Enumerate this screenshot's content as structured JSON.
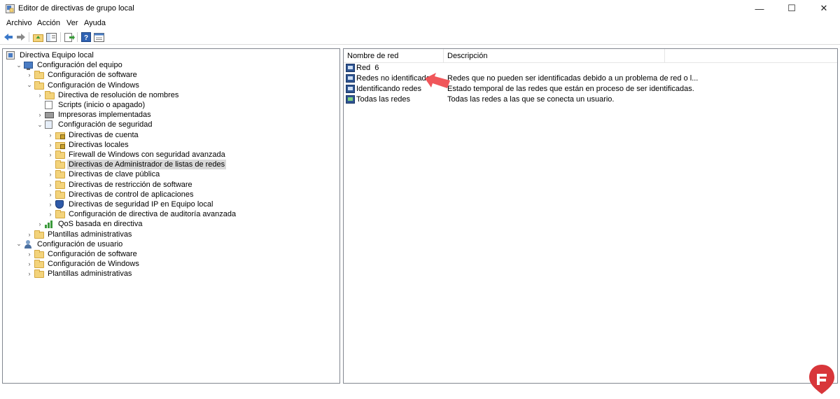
{
  "window": {
    "title": "Editor de directivas de grupo local",
    "controls": {
      "minimize": "—",
      "maximize": "☐",
      "close": "✕"
    }
  },
  "menu": [
    "Archivo",
    "Acción",
    "Ver",
    "Ayuda"
  ],
  "toolbar": {
    "buttons": [
      "back-arrow-icon",
      "forward-arrow-icon",
      "up-folder-icon",
      "show-hide-tree-icon",
      "export-list-icon",
      "help-icon",
      "properties-icon"
    ]
  },
  "tree": [
    {
      "label": "Directiva Equipo local",
      "icon": "group-policy-icon",
      "level": 0,
      "expander": ""
    },
    {
      "label": "Configuración del equipo",
      "icon": "computer-icon",
      "level": 1,
      "expander": "⌄"
    },
    {
      "label": "Configuración de software",
      "icon": "folder-icon",
      "level": 2,
      "expander": "›"
    },
    {
      "label": "Configuración de Windows",
      "icon": "folder-icon",
      "level": 2,
      "expander": "⌄"
    },
    {
      "label": "Directiva de resolución de nombres",
      "icon": "folder-icon",
      "level": 3,
      "expander": "›"
    },
    {
      "label": "Scripts (inicio o apagado)",
      "icon": "document-icon",
      "level": 3,
      "expander": ""
    },
    {
      "label": "Impresoras implementadas",
      "icon": "printer-icon",
      "level": 3,
      "expander": "›"
    },
    {
      "label": "Configuración de seguridad",
      "icon": "security-icon",
      "level": 3,
      "expander": "⌄"
    },
    {
      "label": "Directivas de cuenta",
      "icon": "lock-folder-icon",
      "level": 4,
      "expander": "›"
    },
    {
      "label": "Directivas locales",
      "icon": "lock-folder-icon",
      "level": 4,
      "expander": "›"
    },
    {
      "label": "Firewall de Windows con seguridad avanzada",
      "icon": "folder-icon",
      "level": 4,
      "expander": "›"
    },
    {
      "label": "Directivas de Administrador de listas de redes",
      "icon": "folder-icon",
      "level": 4,
      "expander": "",
      "selected": true
    },
    {
      "label": "Directivas de clave pública",
      "icon": "folder-icon",
      "level": 4,
      "expander": "›"
    },
    {
      "label": "Directivas de restricción de software",
      "icon": "folder-icon",
      "level": 4,
      "expander": "›"
    },
    {
      "label": "Directivas de control de aplicaciones",
      "icon": "folder-icon",
      "level": 4,
      "expander": "›"
    },
    {
      "label": "Directivas de seguridad IP en Equipo local",
      "icon": "shield-icon",
      "level": 4,
      "expander": "›"
    },
    {
      "label": "Configuración de directiva de auditoría avanzada",
      "icon": "folder-icon",
      "level": 4,
      "expander": "›"
    },
    {
      "label": "QoS basada en directiva",
      "icon": "bar-chart-icon",
      "level": 3,
      "expander": "›"
    },
    {
      "label": "Plantillas administrativas",
      "icon": "folder-icon",
      "level": 2,
      "expander": "›"
    },
    {
      "label": "Configuración de usuario",
      "icon": "user-icon",
      "level": 1,
      "expander": "⌄"
    },
    {
      "label": "Configuración de software",
      "icon": "folder-icon",
      "level": 2,
      "expander": "›"
    },
    {
      "label": "Configuración de Windows",
      "icon": "folder-icon",
      "level": 2,
      "expander": "›"
    },
    {
      "label": "Plantillas administrativas",
      "icon": "folder-icon",
      "level": 2,
      "expander": "›"
    }
  ],
  "list": {
    "columns": [
      "Nombre de red",
      "Descripción"
    ],
    "rows": [
      {
        "name": "Red  6",
        "description": "",
        "icon": "network-icon"
      },
      {
        "name": "Redes no identificadas",
        "description": "Redes que no pueden ser identificadas debido a un problema de red o l...",
        "icon": "network-icon"
      },
      {
        "name": "Identificando redes",
        "description": "Estado temporal de las redes que están en proceso de ser identificadas.",
        "icon": "network-icon"
      },
      {
        "name": "Todas las redes",
        "description": "Todas las redes a las que se conecta un usuario.",
        "icon": "network-icon-green"
      }
    ]
  },
  "annotation": {
    "color": "#f0565a"
  },
  "colors": {
    "selection": "#d9d9d9",
    "pane_border": "#828790",
    "folder": "#f3d37b"
  }
}
